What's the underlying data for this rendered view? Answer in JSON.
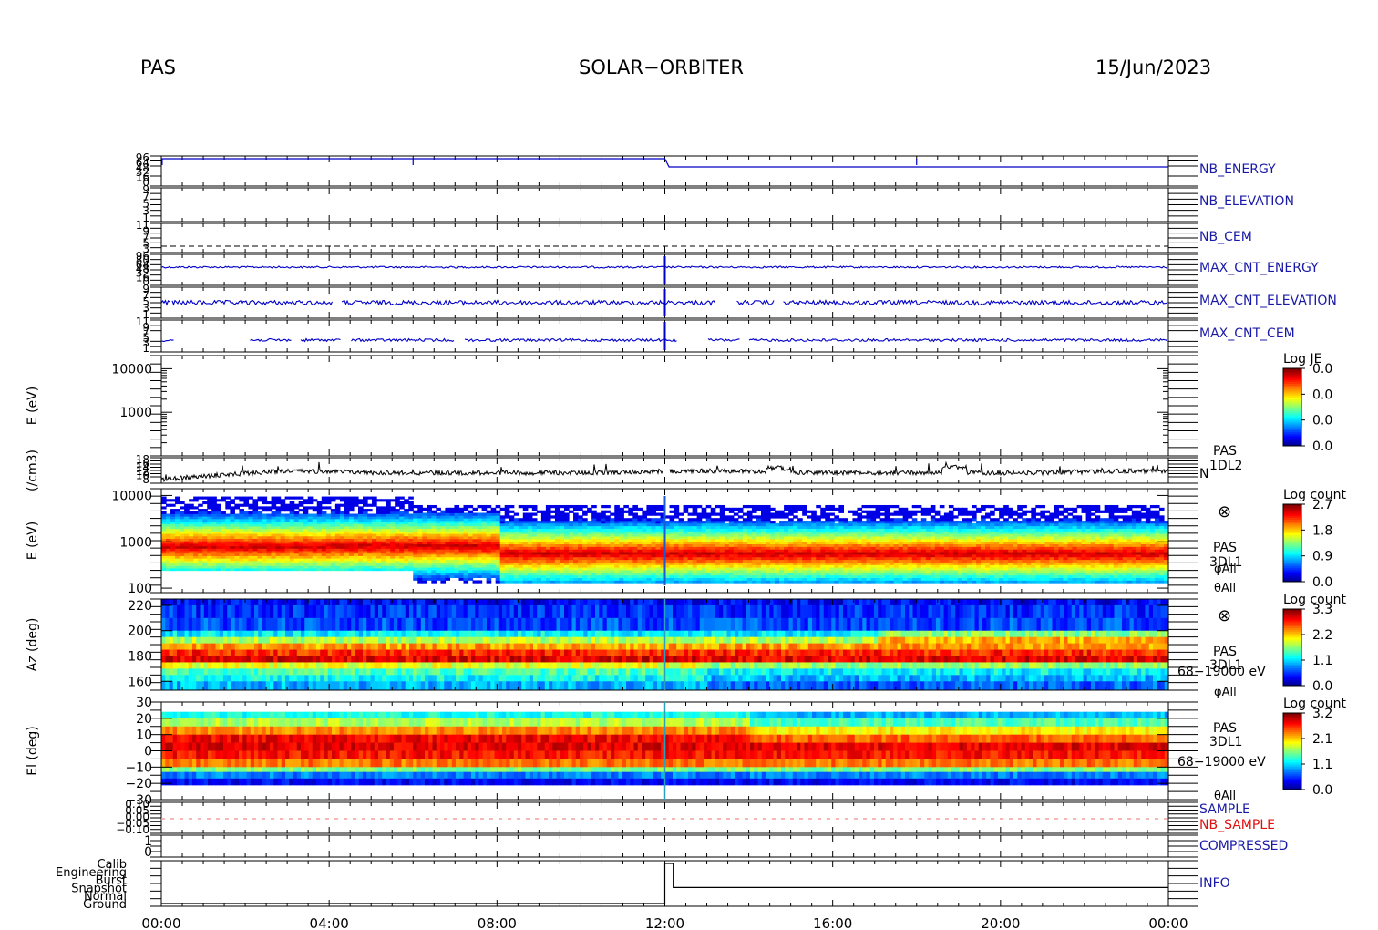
{
  "header": {
    "left": "PAS",
    "center": "SOLAR−ORBITER",
    "right": "15/Jun/2023"
  },
  "colors": {
    "blue_label": "#1a1aa8",
    "red_label": "#e01010",
    "trace_blue": "#0000c8"
  },
  "chart_data": {
    "type": "heatmap",
    "x_ticks": [
      "00:00",
      "04:00",
      "08:00",
      "12:00",
      "16:00",
      "20:00",
      "00:00"
    ],
    "x_range_hours": [
      0,
      24
    ],
    "panels": [
      {
        "id": "nb_energy",
        "type": "line",
        "label": "NB_ENERGY",
        "tick_labels": [
          "96",
          "64",
          "48",
          "32",
          "16",
          "0"
        ],
        "series": [
          {
            "segments": [
              [
                0,
                96
              ],
              [
                12.0,
                96
              ],
              [
                12.1,
                64
              ],
              [
                24,
                64
              ]
            ]
          }
        ]
      },
      {
        "id": "nb_elevation",
        "type": "line",
        "label": "NB_ELEVATION",
        "tick_labels": [
          "9",
          "7",
          "5",
          "3",
          "1"
        ]
      },
      {
        "id": "nb_cem",
        "type": "line",
        "label": "NB_CEM",
        "tick_labels": [
          "11",
          "9",
          "7",
          "5",
          "3"
        ]
      },
      {
        "id": "max_cnt_energy",
        "type": "line",
        "label": "MAX_CNT_ENERGY",
        "tick_labels": [
          "96",
          "80",
          "64",
          "48",
          "32",
          "16",
          "0"
        ]
      },
      {
        "id": "max_cnt_elevation",
        "type": "line",
        "label": "MAX_CNT_ELEVATION",
        "tick_labels": [
          "9",
          "7",
          "5",
          "3",
          "1"
        ]
      },
      {
        "id": "max_cnt_cem",
        "type": "line",
        "label": "MAX_CNT_CEM",
        "tick_labels": [
          "11",
          "9",
          "7",
          "5",
          "3",
          "1"
        ]
      },
      {
        "id": "e_1dl2",
        "type": "heatmap",
        "ylabel": "E (eV)",
        "yticks": [
          "10000",
          "1000"
        ],
        "ylim": [
          100,
          20000
        ],
        "yscale": "log",
        "colorbar": {
          "title": "Log JE",
          "ticks": [
            "0.0",
            "0.0",
            "0.0",
            "0.0"
          ]
        }
      },
      {
        "id": "density",
        "type": "line",
        "ylabel": "(/cm3)",
        "tick_labels": [
          "18",
          "16",
          "14",
          "12",
          "10",
          "8"
        ],
        "label_lines": [
          "PAS",
          "1DL2",
          "N"
        ]
      },
      {
        "id": "e_3dl1",
        "type": "heatmap",
        "ylabel": "E (eV)",
        "yticks": [
          "10000",
          "1000",
          "100"
        ],
        "ylim": [
          80,
          14000
        ],
        "yscale": "log",
        "symbol": "⊗",
        "label_lines": [
          "PAS",
          "3DL1",
          "φAll",
          "θAll"
        ],
        "colorbar": {
          "title": "Log count",
          "ticks": [
            "2.7",
            "1.8",
            "0.9",
            "0.0"
          ]
        }
      },
      {
        "id": "az_3dl1",
        "type": "heatmap",
        "ylabel": "Az (deg)",
        "yticks": [
          "220",
          "200",
          "180",
          "160"
        ],
        "ylim": [
          153,
          225
        ],
        "symbol": "⊗",
        "label_lines": [
          "PAS",
          "3DL1",
          "68−19000 eV",
          "φAll"
        ],
        "colorbar": {
          "title": "Log count",
          "ticks": [
            "3.3",
            "2.2",
            "1.1",
            "0.0"
          ]
        }
      },
      {
        "id": "el_3dl1",
        "type": "heatmap",
        "ylabel": "El (deg)",
        "yticks": [
          "30",
          "20",
          "10",
          "0",
          "−10",
          "−20",
          "−30"
        ],
        "ylim": [
          -30,
          30
        ],
        "label_lines": [
          "PAS",
          "3DL1",
          "68−19000 eV",
          "θAll"
        ],
        "colorbar": {
          "title": "Log count",
          "ticks": [
            "3.2",
            "2.1",
            "1.1",
            "0.0"
          ]
        }
      },
      {
        "id": "sample",
        "type": "line",
        "tick_labels": [
          "0.10",
          "0.05",
          "0.00",
          "−0.05",
          "−0.10"
        ],
        "labels": [
          "SAMPLE",
          "NB_SAMPLE"
        ]
      },
      {
        "id": "compressed",
        "type": "line",
        "label": "COMPRESSED",
        "tick_labels": [
          "1",
          "0"
        ]
      },
      {
        "id": "info",
        "type": "line",
        "label": "INFO",
        "tick_labels": [
          "Calib",
          "Engineering",
          "Burst",
          "Snapshot",
          "Normal",
          "Ground"
        ],
        "series": [
          {
            "segments": [
              [
                0,
                "Ground"
              ],
              [
                12.0,
                "Ground"
              ],
              [
                12.0,
                "Calib"
              ],
              [
                12.2,
                "Calib"
              ],
              [
                12.2,
                "Snapshot"
              ],
              [
                24,
                "Snapshot"
              ]
            ]
          }
        ]
      }
    ]
  }
}
